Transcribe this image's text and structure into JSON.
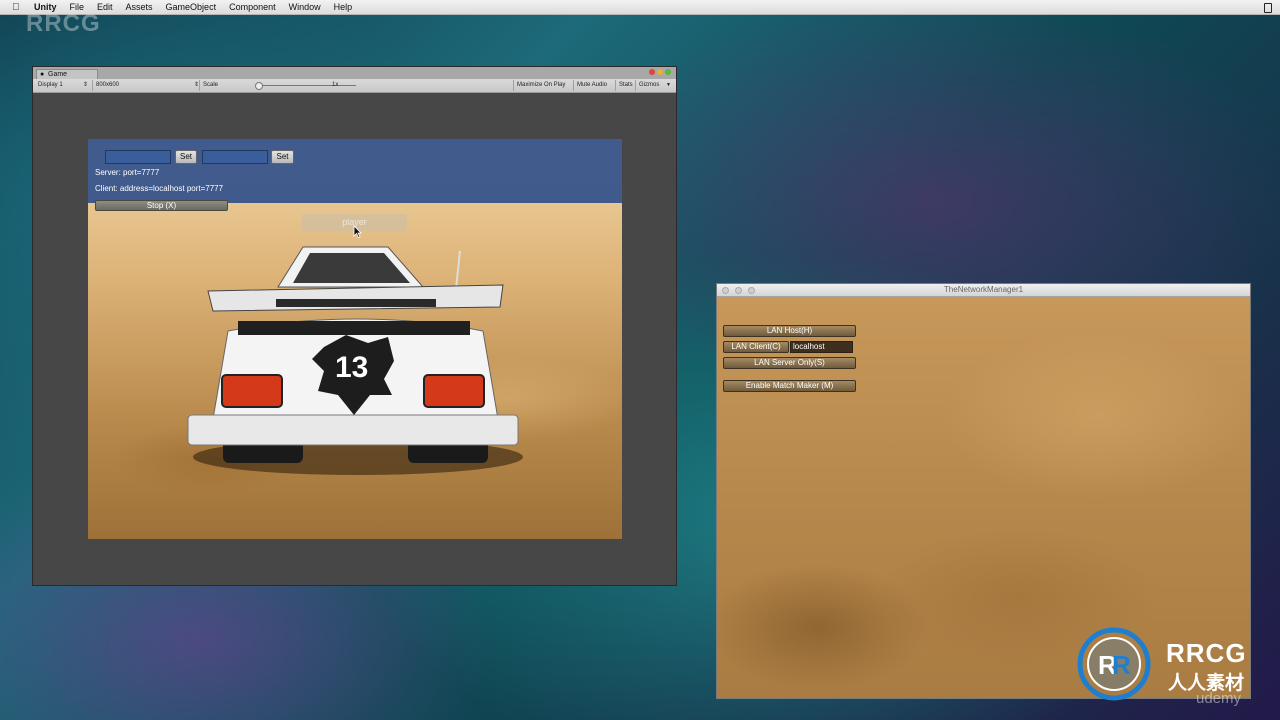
{
  "menubar": {
    "app": "Unity",
    "items": [
      "File",
      "Edit",
      "Assets",
      "GameObject",
      "Component",
      "Window",
      "Help"
    ]
  },
  "watermark_top": "RRCG",
  "game_window": {
    "tab_label": "Game",
    "toolbar": {
      "display": "Display 1",
      "resolution": "800x600",
      "scale_label": "Scale",
      "scale_value": "1x",
      "maximize_on_play": "Maximize On Play",
      "mute_audio": "Mute Audio",
      "stats": "Stats",
      "gizmos": "Gizmos"
    },
    "hud": {
      "set_label_1": "Set",
      "set_label_2": "Set",
      "server_text": "Server: port=7777",
      "client_text": "Client: address=localhost port=7777",
      "stop_label": "Stop (X)",
      "player_label": "player"
    },
    "car_number": "13"
  },
  "network_window": {
    "title": "TheNetworkManager1",
    "lan_host": "LAN Host(H)",
    "lan_client": "LAN Client(C)",
    "client_address": "localhost",
    "lan_server_only": "LAN Server Only(S)",
    "match_maker": "Enable Match Maker (M)"
  },
  "logo": {
    "line1": "RRCG",
    "line2": "人人素材",
    "udemy": "udemy"
  },
  "colors": {
    "hud_blue": "#34528c",
    "sand": "#c7985a",
    "logo_blue": "#1e7fd0"
  }
}
